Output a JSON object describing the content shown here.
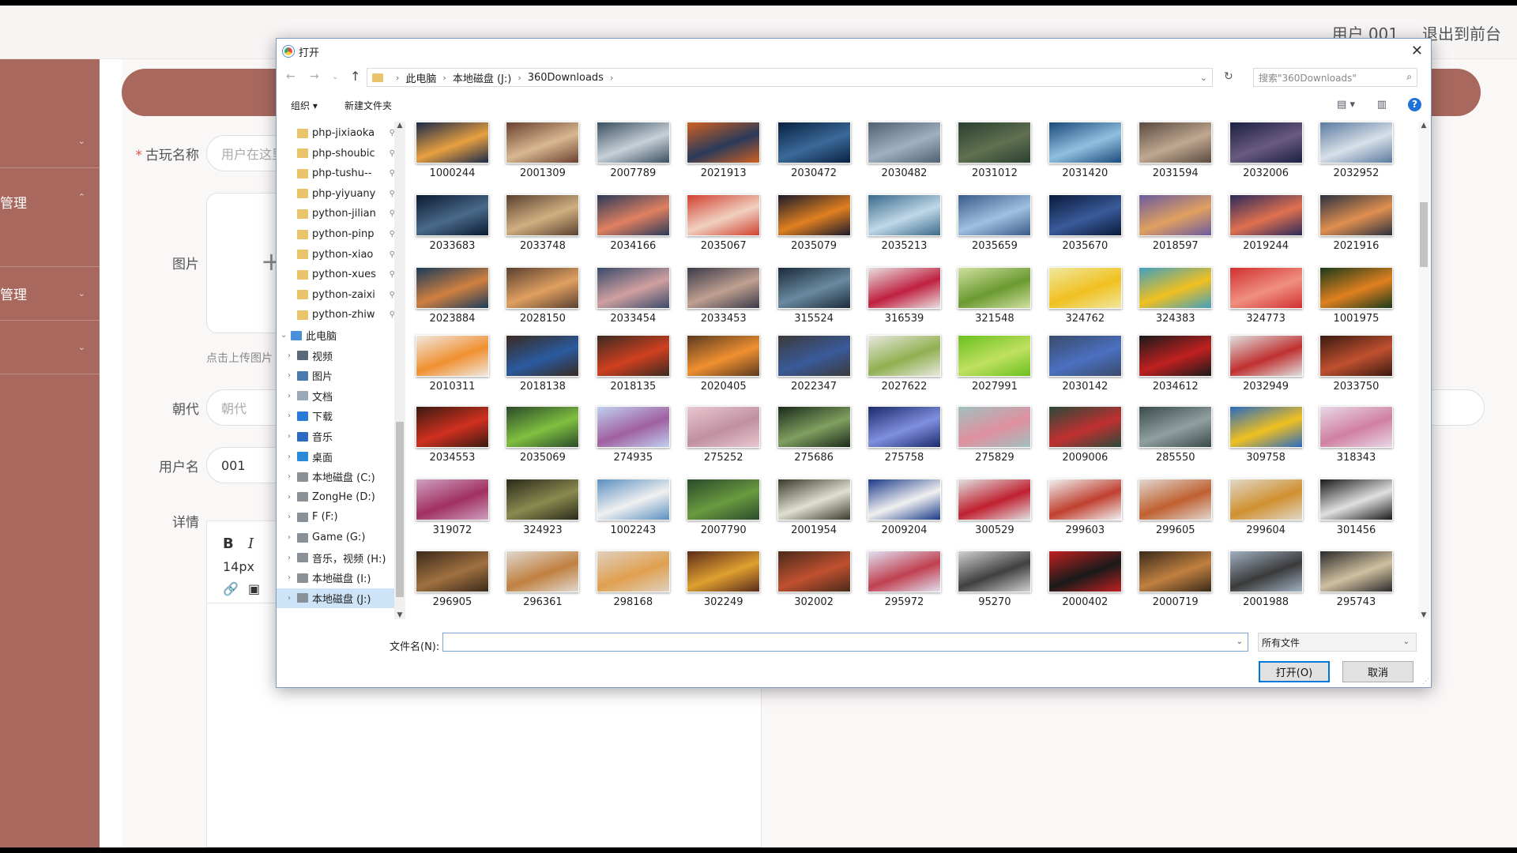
{
  "app": {
    "user_label": "用户 001",
    "exit_label": "退出到前台",
    "sidebar_items": [
      "",
      "管理",
      "管理",
      ""
    ],
    "form": {
      "name_label": "古玩名称",
      "name_placeholder": "用户在这里",
      "image_label": "图片",
      "upload_hint": "点击上传图片",
      "dynasty_label": "朝代",
      "dynasty_placeholder": "朝代",
      "username_label": "用户名",
      "username_value": "001",
      "detail_label": "详情",
      "font_size": "14px",
      "bold": "B",
      "italic": "I"
    }
  },
  "dialog": {
    "title": "打开",
    "close": "✕",
    "breadcrumb": [
      "此电脑",
      "本地磁盘 (J:)",
      "360Downloads"
    ],
    "search_placeholder": "搜索\"360Downloads\"",
    "organize": "组织 ▾",
    "new_folder": "新建文件夹",
    "help": "?",
    "tree": [
      {
        "label": "php-jixiaoka",
        "pinned": true,
        "kind": "folder"
      },
      {
        "label": "php-shoubic",
        "pinned": true,
        "kind": "folder"
      },
      {
        "label": "php-tushu--",
        "pinned": true,
        "kind": "folder"
      },
      {
        "label": "php-yiyuany",
        "pinned": true,
        "kind": "folder"
      },
      {
        "label": "python-jilian",
        "pinned": true,
        "kind": "folder"
      },
      {
        "label": "python-pinp",
        "pinned": true,
        "kind": "folder"
      },
      {
        "label": "python-xiao",
        "pinned": true,
        "kind": "folder"
      },
      {
        "label": "python-xues",
        "pinned": true,
        "kind": "folder"
      },
      {
        "label": "python-zaixi",
        "pinned": true,
        "kind": "folder"
      },
      {
        "label": "python-zhiw",
        "pinned": true,
        "kind": "folder"
      },
      {
        "label": "此电脑",
        "kind": "pc",
        "expanded": true
      },
      {
        "label": "视频",
        "kind": "video"
      },
      {
        "label": "图片",
        "kind": "pictures"
      },
      {
        "label": "文档",
        "kind": "docs"
      },
      {
        "label": "下载",
        "kind": "download"
      },
      {
        "label": "音乐",
        "kind": "music"
      },
      {
        "label": "桌面",
        "kind": "desktop"
      },
      {
        "label": "本地磁盘 (C:)",
        "kind": "drive"
      },
      {
        "label": "ZongHe (D:)",
        "kind": "drive"
      },
      {
        "label": "F (F:)",
        "kind": "drive"
      },
      {
        "label": "Game (G:)",
        "kind": "drive"
      },
      {
        "label": "音乐，视频 (H:)",
        "kind": "drive"
      },
      {
        "label": "本地磁盘 (I:)",
        "kind": "drive"
      },
      {
        "label": "本地磁盘 (J:)",
        "kind": "drive",
        "selected": true
      }
    ],
    "files": [
      "1000244",
      "2001309",
      "2007789",
      "2021913",
      "2030472",
      "2030482",
      "2031012",
      "2031420",
      "2031594",
      "2032006",
      "2032952",
      "2033683",
      "2033748",
      "2034166",
      "2035067",
      "2035079",
      "2035213",
      "2035659",
      "2035670",
      "2018597",
      "2019244",
      "2021916",
      "2023884",
      "2028150",
      "2033454",
      "2033453",
      "315524",
      "316539",
      "321548",
      "324762",
      "324383",
      "324773",
      "1001975",
      "2010311",
      "2018138",
      "2018135",
      "2020405",
      "2022347",
      "2027622",
      "2027991",
      "2030142",
      "2034612",
      "2032949",
      "2033750",
      "2034553",
      "2035069",
      "274935",
      "275252",
      "275686",
      "275758",
      "275829",
      "2009006",
      "285550",
      "309758",
      "318343",
      "319072",
      "324923",
      "1002243",
      "2007790",
      "2001954",
      "2009204",
      "300529",
      "299603",
      "299605",
      "299604",
      "301456",
      "296905",
      "296361",
      "298168",
      "302249",
      "302002",
      "295972",
      "95270",
      "2000402",
      "2000719",
      "2001988",
      "295743"
    ],
    "thumb_colors": [
      [
        "#1a2a4a",
        "#e8a040"
      ],
      [
        "#6a4030",
        "#d8b890"
      ],
      [
        "#3a5060",
        "#c8d0d8"
      ],
      [
        "#d06020",
        "#2a3a5a"
      ],
      [
        "#0a2040",
        "#3a6a9a"
      ],
      [
        "#506070",
        "#a0b0c0"
      ],
      [
        "#2a4030",
        "#607050"
      ],
      [
        "#1a4a7a",
        "#90c0e0"
      ],
      [
        "#5a4a40",
        "#c0a890"
      ],
      [
        "#1a2040",
        "#6a5a80"
      ],
      [
        "#5a7aa0",
        "#d8e0e8"
      ],
      [
        "#0a1a30",
        "#4a6a8a"
      ],
      [
        "#5a4030",
        "#d0b080"
      ],
      [
        "#2a3a5a",
        "#e08060"
      ],
      [
        "#d04030",
        "#f0d0c0"
      ],
      [
        "#1a1a2a",
        "#e08020"
      ],
      [
        "#3a6a8a",
        "#c0d8e8"
      ],
      [
        "#3a5a8a",
        "#a0c0e0"
      ],
      [
        "#0a1a3a",
        "#3a5a9a"
      ],
      [
        "#6a5aa0",
        "#e0a060"
      ],
      [
        "#2a2a5a",
        "#e07050"
      ],
      [
        "#2a3040",
        "#e09050"
      ],
      [
        "#1a3a5a",
        "#d08040"
      ],
      [
        "#5a4030",
        "#e0a060"
      ],
      [
        "#3a4a6a",
        "#d0a0a0"
      ],
      [
        "#3a3a4a",
        "#c0a090"
      ],
      [
        "#1a2a3a",
        "#6a8aa0"
      ],
      [
        "#e8e0e0",
        "#c02040"
      ],
      [
        "#d0e0a0",
        "#6a9a30"
      ],
      [
        "#f0e8a0",
        "#f0c020"
      ],
      [
        "#40a0c0",
        "#f0c020"
      ],
      [
        "#d03030",
        "#f09080"
      ],
      [
        "#1a3a1a",
        "#e08020"
      ],
      [
        "#f0e8e0",
        "#f09030"
      ],
      [
        "#3a2a20",
        "#2a5aa0"
      ],
      [
        "#3a2a20",
        "#d04020"
      ],
      [
        "#5a3a20",
        "#f09030"
      ],
      [
        "#3a3a3a",
        "#3a5a9a"
      ],
      [
        "#e8e8e0",
        "#90b050"
      ],
      [
        "#6ac020",
        "#c0e060"
      ],
      [
        "#3a4a6a",
        "#4a70c0"
      ],
      [
        "#1a1a1a",
        "#c02020"
      ],
      [
        "#e0e0e0",
        "#c03030"
      ],
      [
        "#3a1a10",
        "#c05030"
      ],
      [
        "#3a1a10",
        "#d03020"
      ],
      [
        "#2a4a2a",
        "#80c040"
      ],
      [
        "#c0d0f0",
        "#a060a0"
      ],
      [
        "#e8c8d0",
        "#c090a0"
      ],
      [
        "#1a2a1a",
        "#80a060"
      ],
      [
        "#1a2a6a",
        "#8090e0"
      ],
      [
        "#a0c0c0",
        "#e090a0"
      ],
      [
        "#2a4a3a",
        "#c03030"
      ],
      [
        "#3a4a4a",
        "#90a0a0"
      ],
      [
        "#2a6ac0",
        "#f0c020"
      ],
      [
        "#e8d8e8",
        "#d080a0"
      ],
      [
        "#d0a0c0",
        "#a03060"
      ],
      [
        "#2a2a1a",
        "#8a8a50"
      ],
      [
        "#5a90c0",
        "#f0f0f0"
      ],
      [
        "#2a4a2a",
        "#6a9a40"
      ],
      [
        "#3a3a2a",
        "#e0e0d0"
      ],
      [
        "#1a3a8a",
        "#f0f0f0"
      ],
      [
        "#e0e0e0",
        "#c02030"
      ],
      [
        "#f0f0f0",
        "#c04030"
      ],
      [
        "#e0d8d0",
        "#c06030"
      ],
      [
        "#e0d8c8",
        "#d09030"
      ],
      [
        "#1a1a1a",
        "#e0e0e0"
      ],
      [
        "#3a2a1a",
        "#a07040"
      ],
      [
        "#e0d8d0",
        "#c08040"
      ],
      [
        "#e0d0c0",
        "#e0a050"
      ],
      [
        "#5a2a1a",
        "#e0a030"
      ],
      [
        "#4a2a1a",
        "#c05030"
      ],
      [
        "#e0e0f0",
        "#c04050"
      ],
      [
        "#d0d0d0",
        "#404040"
      ],
      [
        "#c02020",
        "#1a1a1a"
      ],
      [
        "#3a2a1a",
        "#c08040"
      ],
      [
        "#a0b0c0",
        "#3a3a3a"
      ],
      [
        "#2a2a2a",
        "#d0c0a0"
      ]
    ],
    "filename_label": "文件名(N):",
    "filename_value": "",
    "filetype": "所有文件",
    "open_btn": "打开(O)",
    "cancel_btn": "取消"
  }
}
